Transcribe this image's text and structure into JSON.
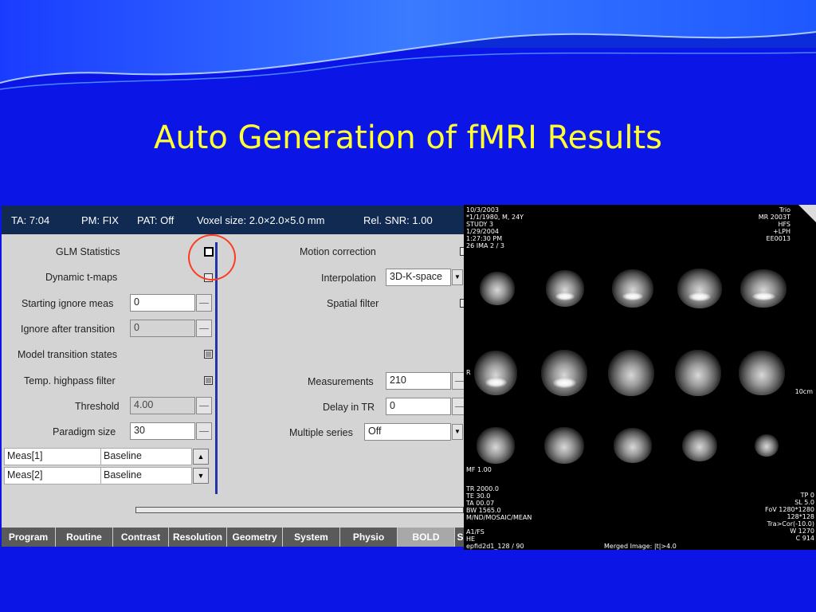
{
  "slide": {
    "title": "Auto Generation of fMRI Results"
  },
  "header": {
    "ta": "TA: 7:04",
    "pm": "PM: FIX",
    "pat": "PAT: Off",
    "voxel": "Voxel size: 2.0×2.0×5.0 mm",
    "snr": "Rel. SNR: 1.00"
  },
  "left": {
    "glm_label": "GLM Statistics",
    "glm_checked": false,
    "dynamic_label": "Dynamic t-maps",
    "dynamic_checked": false,
    "starting_ignore_label": "Starting ignore meas",
    "starting_ignore_value": "0",
    "ignore_after_label": "Ignore after transition",
    "ignore_after_value": "0",
    "model_transition_label": "Model transition states",
    "model_transition_checked": true,
    "temp_highpass_label": "Temp. highpass filter",
    "temp_highpass_checked": true,
    "threshold_label": "Threshold",
    "threshold_value": "4.00",
    "paradigm_label": "Paradigm size",
    "paradigm_value": "30",
    "table": [
      {
        "meas": "Meas[1]",
        "state": "Baseline"
      },
      {
        "meas": "Meas[2]",
        "state": "Baseline"
      }
    ]
  },
  "right": {
    "motion_label": "Motion correction",
    "interpolation_label": "Interpolation",
    "interpolation_value": "3D-K-space",
    "spatial_label": "Spatial filter",
    "measurements_label": "Measurements",
    "measurements_value": "210",
    "delay_label": "Delay in TR",
    "delay_value": "0",
    "multiple_label": "Multiple series",
    "multiple_value": "Off"
  },
  "tabs": [
    "Program",
    "Routine",
    "Contrast",
    "Resolution",
    "Geometry",
    "System",
    "Physio",
    "BOLD",
    "S"
  ],
  "active_tab": "BOLD",
  "mri": {
    "top_left": "10/3/2003\n*1/1/1980, M, 24Y\nSTUDY 3\n1/29/2004\n1:27:30 PM\n26 IMA 2 / 3",
    "top_right": "Trio\nMR 2003T\nHFS\n+LPH\nEE0013",
    "r_marker": "R",
    "scale": "10cm",
    "mf": "MF 1.00",
    "bottom_left": "TR 2000.0\nTE 30.0\nTA 00.07\nBW 1565.0\nM/ND/MOSAIC/MEAN\n\nA1/FS\nHE\nepfid2d1_128 / 90",
    "bottom_center": "Merged Image: |t|>4.0",
    "bottom_right": "TP 0\nSL 5.0\nFoV 1280*1280\n128*128\nTra>Cor(-10.0)\nW 1270\nC 914"
  }
}
